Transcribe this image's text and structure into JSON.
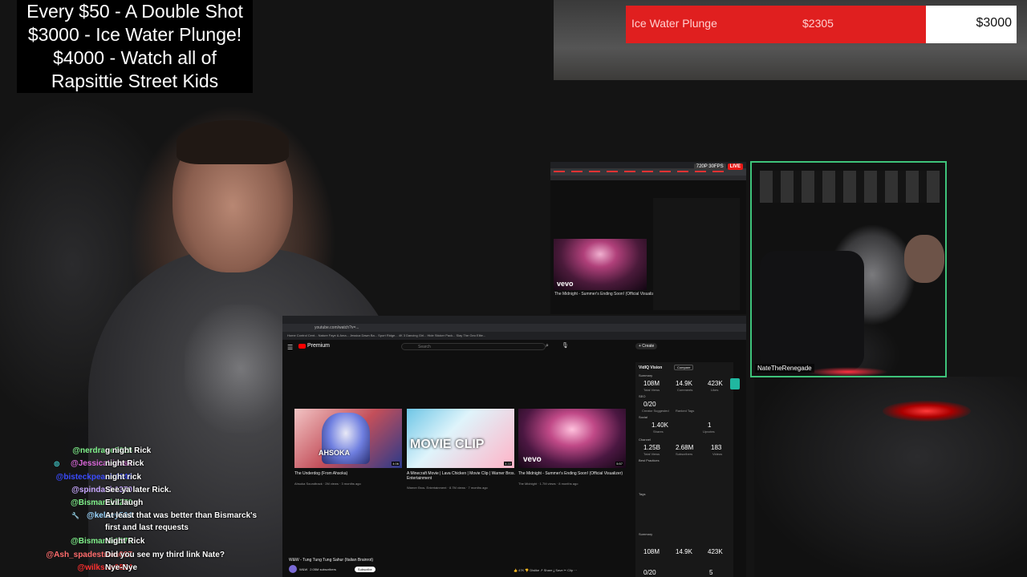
{
  "goals_overlay": {
    "lines": [
      "Every $50 - A Double Shot",
      "$3000 - Ice Water Plunge!",
      "$4000 - Watch all of",
      "Rapsittie Street Kids"
    ]
  },
  "goal_bar": {
    "name": "Ice Water Plunge",
    "current": "$2305",
    "target": "$3000",
    "progress_fraction": 0.768,
    "fill_color": "#e01f1f"
  },
  "small_capture": {
    "resolution_badge": "720P 30FPS",
    "live_badge": "LIVE",
    "video_title": "The Midnight - Summer's Ending Soon! (Official Visualizer)",
    "thumb_brand": "vevo"
  },
  "browser": {
    "address": "youtube.com/watch?v=...",
    "bookmarks": "Home Control Cent...   Nature Faye & Ama...   Jessica Dawn Ba...   Sport Ridge...   4K 3 Dancing Girl...   Hide Sticker Pack...   Slay The Geo Elite...",
    "yt_logo": "Premium",
    "search_placeholder": "Search",
    "create_label": "+ Create",
    "videos": [
      {
        "title": "The Underdog (From Ahsoka)",
        "meta": "Ahsoka Soundtrack · 2M views · 3 months ago",
        "duration": "4:06",
        "thumb_text": "AHSOKA"
      },
      {
        "title": "A Minecraft Movie | Lava Chicken | Movie Clip | Warner Bros. Entertainment",
        "meta": "Warner Bros. Entertainment · 8.7M views · 7 months ago",
        "duration": "4:22",
        "thumb_text": "MOVIE CLIP"
      },
      {
        "title": "The Midnight - Summer's Ending Soon! (Official Visualizer)",
        "meta": "The Midnight · 1.7M views · 8 months ago",
        "duration": "5:57",
        "thumb_text": "vevo"
      }
    ],
    "player_title": "W&W - Tung Tung Tung Sahur (Italian Brainrot)",
    "channel": "W&W",
    "subscribers": "2.05M subscribers",
    "subscribe_label": "Subscribe",
    "actions": "👍 47K   👎 Dislike   ↗ Share   ⤓ Save   ✂ Clip   ⋯"
  },
  "vidiq": {
    "title": "VidIQ Vision",
    "dropdown": "Compare",
    "summary_label": "Summary",
    "views": "108M",
    "views_label": "Total Views",
    "comments": "14.9K",
    "comments_label": "Comments",
    "likes": "423K",
    "likes_label": "Likes",
    "seo_label": "SEO",
    "seo_score": "0/20",
    "seo_score_label": "Creator Suggested",
    "ranked_label": "Ranked Tags",
    "social_label": "Social",
    "social_1": "1.40K",
    "social_1_label": "Shares",
    "social_2": "1",
    "social_2_label": "Upvotes",
    "channel_label": "Channel",
    "ch_1": "1.25B",
    "ch_1_label": "Total Views",
    "ch_2": "2.68M",
    "ch_2_label": "Subscribers",
    "ch_3": "183",
    "ch_3_label": "Videos",
    "best_practices": "Best Practices",
    "tags_label": "Tags",
    "summary2_views": "108M",
    "summary2_comments": "14.9K",
    "summary2_likes": "423K",
    "summary2_seo": "0/20",
    "summary2_five": "5"
  },
  "cam2": {
    "label": "NateTheRenegade"
  },
  "chat": [
    {
      "user": "@nerdrage3626",
      "msg": "g night Rick",
      "color": "#7ff08a",
      "icon": ""
    },
    {
      "user": "@JessicaLiesse",
      "msg": "night Rick",
      "color": "#d866d8",
      "icon": "◎"
    },
    {
      "user": "@bisteckpeach4649",
      "msg": "night rick",
      "color": "#3a4bff",
      "icon": ""
    },
    {
      "user": "@spindash1370",
      "msg": "See ya later Rick.",
      "color": "#c8a8ff",
      "icon": ""
    },
    {
      "user": "@Bismarck1270",
      "msg": "Evil laugh",
      "color": "#7ff08a",
      "icon": ""
    },
    {
      "user": "@kelsey504",
      "msg": "At least that was better than Bismarck's first and last requests",
      "color": "#9ad6ff",
      "icon": "🔧"
    },
    {
      "user": "@Bismarck1270",
      "msg": "Night Rick",
      "color": "#7ff08a",
      "icon": ""
    },
    {
      "user": "@Ash_spadestrom097",
      "msg": "Did you see my third link Nate?",
      "color": "#ff6b6b",
      "icon": ""
    },
    {
      "user": "@wilkson9824",
      "msg": "Nye-Nye",
      "color": "#ff3030",
      "icon": ""
    }
  ]
}
